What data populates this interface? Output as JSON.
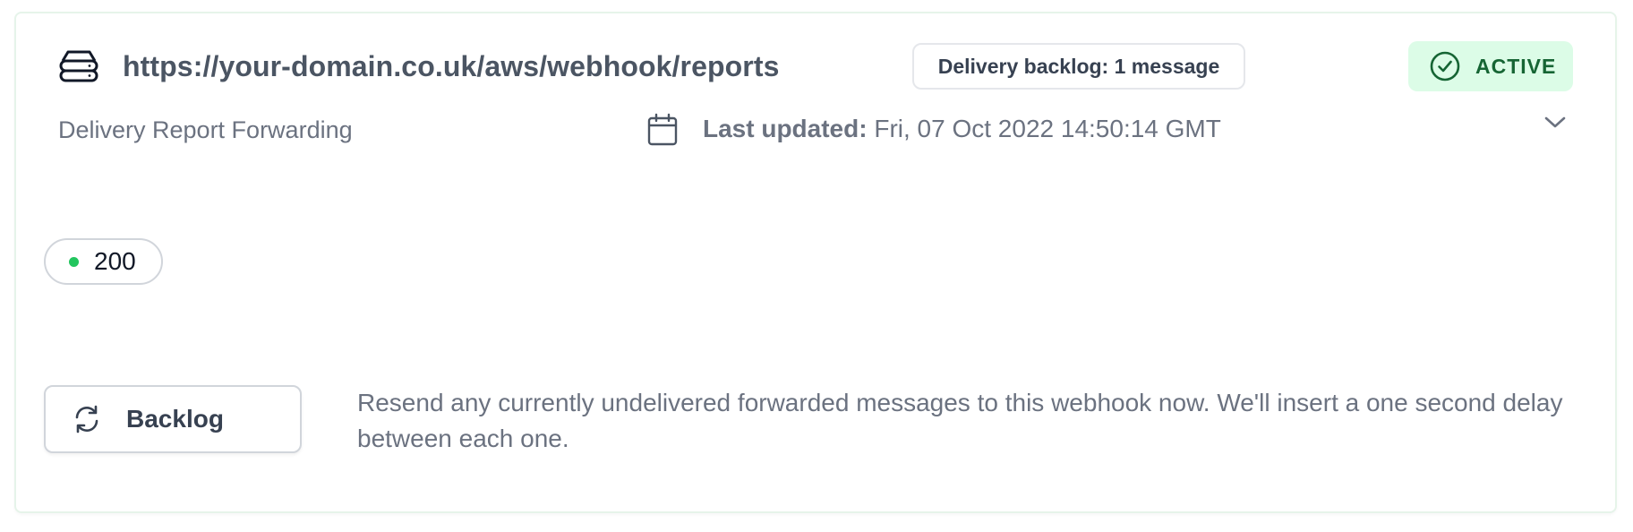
{
  "webhook": {
    "url": "https://your-domain.co.uk/aws/webhook/reports",
    "backlog_badge": "Delivery backlog: 1 message",
    "status": "ACTIVE",
    "subtitle": "Delivery Report Forwarding",
    "last_updated_label": "Last updated:",
    "last_updated_value": " Fri, 07 Oct 2022 14:50:14 GMT",
    "response_code": "200"
  },
  "actions": {
    "backlog_button": "Backlog",
    "backlog_description": "Resend any currently undelivered forwarded messages to this webhook now. We'll insert a one second delay between each one."
  },
  "icons": {
    "server": "server-icon",
    "calendar": "calendar-icon",
    "check": "check-circle-icon",
    "chevron": "chevron-down-icon",
    "refresh": "refresh-icon"
  },
  "colors": {
    "status_bg": "#dcfce7",
    "status_text": "#166534",
    "ok_dot": "#22c55e"
  }
}
